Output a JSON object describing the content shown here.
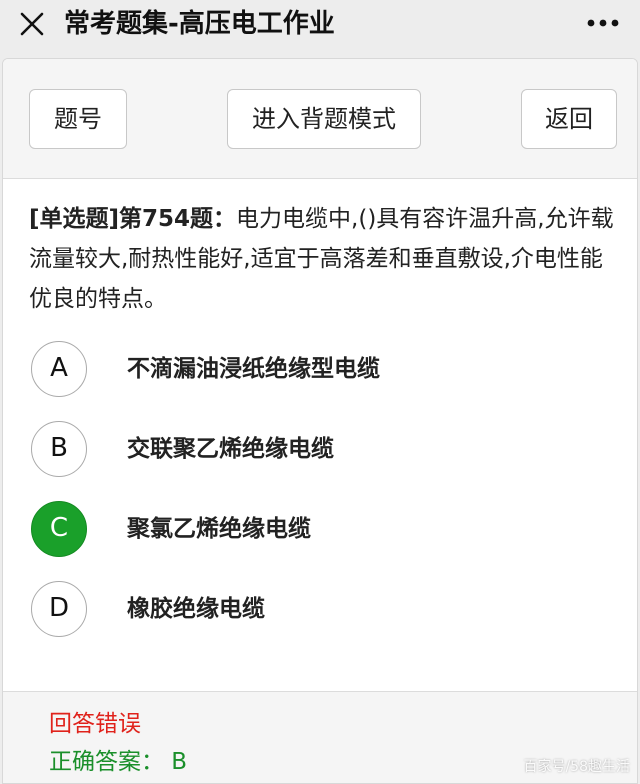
{
  "header": {
    "title": "常考题集-高压电工作业",
    "close_icon": "close-icon",
    "more_icon": "more-icon"
  },
  "toolbar": {
    "number_label": "题号",
    "mode_label": "进入背题模式",
    "back_label": "返回"
  },
  "question": {
    "tag": "[单选题]第754题：",
    "text": "电力电缆中,()具有容许温升高,允许载流量较大,耐热性能好,适宜于高落差和垂直敷设,介电性能优良的特点。"
  },
  "options": [
    {
      "letter": "A",
      "text": "不滴漏油浸纸绝缘型电缆",
      "selected": false
    },
    {
      "letter": "B",
      "text": "交联聚乙烯绝缘电缆",
      "selected": false
    },
    {
      "letter": "C",
      "text": "聚氯乙烯绝缘电缆",
      "selected": true
    },
    {
      "letter": "D",
      "text": "橡胶绝缘电缆",
      "selected": false
    }
  ],
  "result": {
    "status": "回答错误",
    "correct_answer": "正确答案： B"
  },
  "colors": {
    "selected": "#1aa02a",
    "wrong": "#e0221b",
    "correct": "#1a8f2a"
  },
  "watermark": "百家号/58趣生活"
}
